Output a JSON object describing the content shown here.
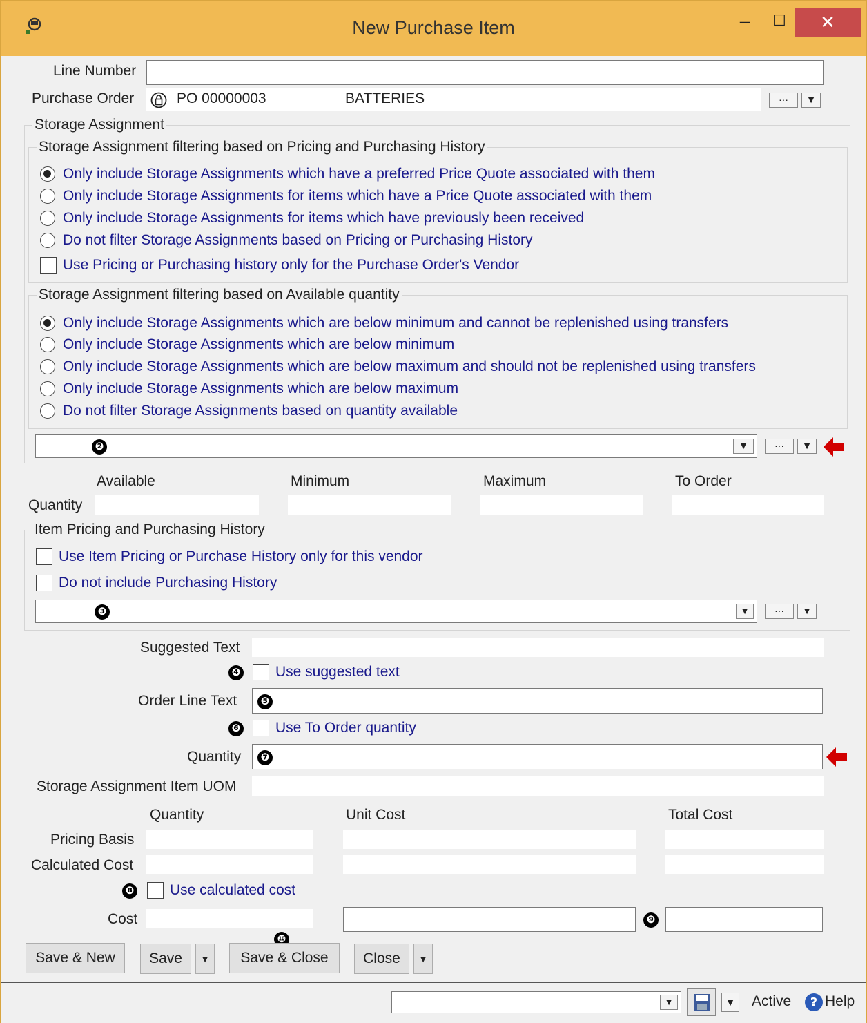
{
  "window": {
    "title": "New Purchase Item",
    "minimize": "‒",
    "maximize": "☐",
    "close": "✕"
  },
  "header": {
    "line_number_label": "Line Number",
    "line_number_value": "",
    "purchase_order_label": "Purchase Order",
    "purchase_order_value": "PO 00000003",
    "purchase_order_desc": "BATTERIES"
  },
  "storage": {
    "legend": "Storage Assignment",
    "pricing_legend": "Storage Assignment filtering based on Pricing and Purchasing History",
    "pricing_options": [
      "Only include Storage Assignments which have a preferred Price Quote associated with them",
      "Only include Storage Assignments for items which have a Price Quote associated with them",
      "Only include Storage Assignments for items which have previously been received",
      "Do not filter Storage Assignments based on Pricing or Purchasing History"
    ],
    "pricing_selected": 0,
    "vendor_only_label": "Use Pricing or Purchasing history only for the Purchase Order's Vendor",
    "vendor_only_checked": false,
    "qty_legend": "Storage Assignment filtering based on Available quantity",
    "qty_options": [
      "Only include Storage Assignments which are below minimum and cannot be replenished using transfers",
      "Only include Storage Assignments which are below minimum",
      "Only include Storage Assignments which are below maximum and should not be replenished using transfers",
      "Only include Storage Assignments which are below maximum",
      "Do not filter Storage Assignments based on quantity available"
    ],
    "qty_selected": 0,
    "combo_value": ""
  },
  "quantity_row": {
    "label": "Quantity",
    "headers": [
      "Available",
      "Minimum",
      "Maximum",
      "To Order"
    ]
  },
  "pricing_history": {
    "legend": "Item Pricing and Purchasing History",
    "vendor_only_label": "Use Item Pricing or Purchase History only for this vendor",
    "no_history_label": "Do not include Purchasing History",
    "combo_value": ""
  },
  "order": {
    "suggested_text_label": "Suggested Text",
    "use_suggested_label": "Use suggested text",
    "order_line_text_label": "Order Line Text",
    "use_to_order_label": "Use To Order quantity",
    "quantity_label": "Quantity",
    "uom_label": "Storage Assignment Item UOM"
  },
  "cost": {
    "headers": [
      "Quantity",
      "Unit Cost",
      "Total Cost"
    ],
    "pricing_basis_label": "Pricing Basis",
    "calculated_cost_label": "Calculated Cost",
    "use_calculated_label": "Use calculated cost",
    "cost_label": "Cost"
  },
  "markers": [
    "❷",
    "❸",
    "❹",
    "❺",
    "❻",
    "❼",
    "❽",
    "❾",
    "❿"
  ],
  "buttons": {
    "save_new": "Save & New",
    "save": "Save",
    "save_close": "Save & Close",
    "close": "Close"
  },
  "status": {
    "active": "Active",
    "help": "Help"
  },
  "ellipsis": "···",
  "colors": {
    "titlebar": "#f1ba53",
    "close_button": "#c74b4b",
    "link_text": "#1a1a8c",
    "required_arrow": "#d10000"
  }
}
